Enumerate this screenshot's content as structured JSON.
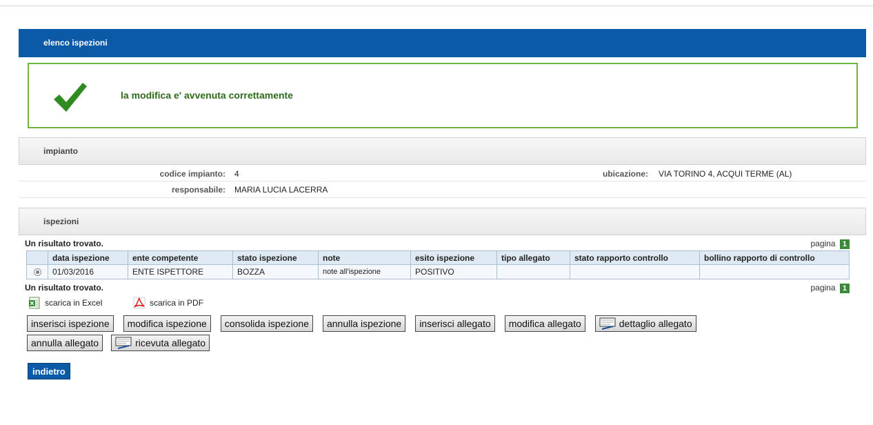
{
  "title": "elenco ispezioni",
  "success_message": "la modifica e' avvenuta correttamente",
  "impianto": {
    "section_label": "impianto",
    "codice_label": "codice impianto:",
    "codice_value": "4",
    "ubicazione_label": "ubicazione:",
    "ubicazione_value": "VIA TORINO 4, ACQUI TERME (AL)",
    "responsabile_label": "responsabile:",
    "responsabile_value": "MARIA LUCIA LACERRA"
  },
  "ispezioni": {
    "section_label": "ispezioni",
    "result_count": "Un risultato trovato.",
    "pagina_label": "pagina",
    "page_number": "1",
    "columns": [
      "data ispezione",
      "ente competente",
      "stato ispezione",
      "note",
      "esito ispezione",
      "tipo allegato",
      "stato rapporto controllo",
      "bollino rapporto di controllo"
    ],
    "rows": [
      {
        "data": "01/03/2016",
        "ente": "ENTE ISPETTORE",
        "stato": "BOZZA",
        "note": "note all'ispezione",
        "esito": "POSITIVO",
        "tipo_allegato": "",
        "stato_rapporto": "",
        "bollino": ""
      }
    ]
  },
  "downloads": {
    "excel": "scarica in Excel",
    "pdf": "scarica in PDF"
  },
  "buttons": {
    "inserisci_ispezione": "inserisci ispezione",
    "modifica_ispezione": "modifica ispezione",
    "consolida_ispezione": "consolida ispezione",
    "annulla_ispezione": "annulla ispezione",
    "inserisci_allegato": "inserisci allegato",
    "modifica_allegato": "modifica allegato",
    "dettaglio_allegato": "dettaglio allegato",
    "annulla_allegato": "annulla allegato",
    "ricevuta_allegato": "ricevuta allegato"
  },
  "back_label": "indietro",
  "colors": {
    "header_blue": "#0a5aa8",
    "success_green": "#6cb33f",
    "success_text": "#2e6b1a",
    "page_badge": "#3a8a3a"
  }
}
